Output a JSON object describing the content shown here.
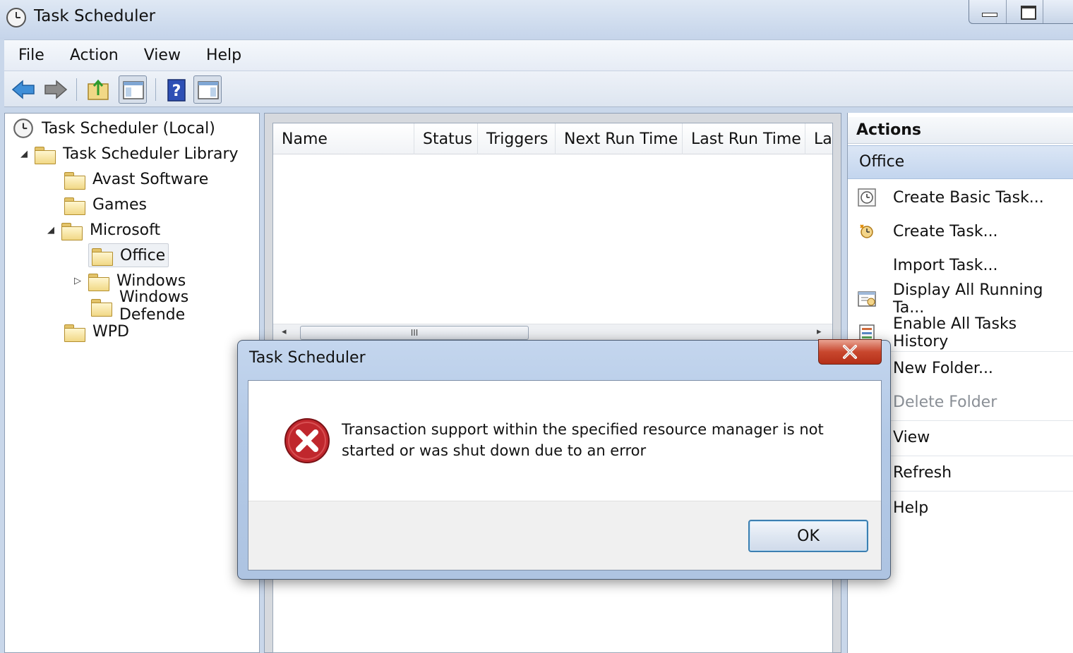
{
  "window": {
    "title": "Task Scheduler"
  },
  "menu": [
    "File",
    "Action",
    "View",
    "Help"
  ],
  "tree": {
    "root": "Task Scheduler (Local)",
    "library": "Task Scheduler Library",
    "items": [
      "Avast Software",
      "Games",
      "Microsoft",
      "Office",
      "Windows",
      "Windows Defende",
      "WPD"
    ]
  },
  "list": {
    "columns": [
      "Name",
      "Status",
      "Triggers",
      "Next Run Time",
      "Last Run Time",
      "La"
    ],
    "scroll_grip": "III"
  },
  "actions": {
    "header": "Actions",
    "section": "Office",
    "items": [
      "Create Basic Task...",
      "Create Task...",
      "Import Task...",
      "Display All Running Ta...",
      "Enable All Tasks History",
      "New Folder...",
      "Delete Folder",
      "View",
      "Refresh",
      "Help"
    ]
  },
  "dialog": {
    "title": "Task Scheduler",
    "message": "Transaction support within the specified resource manager is not started or was shut down due to an error",
    "ok_label": "OK"
  },
  "colors": {
    "accent": "#3c7fb1",
    "close_button": "#c8472e",
    "error_red": "#c0272d"
  }
}
